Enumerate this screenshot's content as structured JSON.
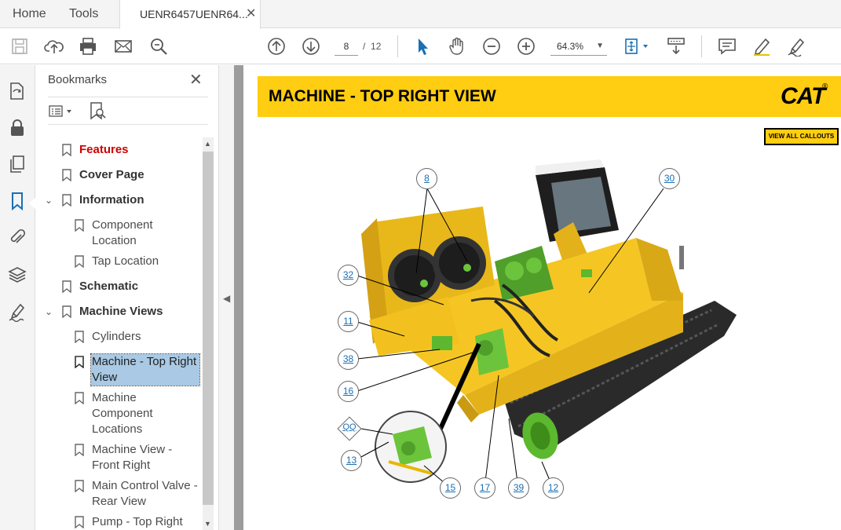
{
  "menu": {
    "home": "Home",
    "tools": "Tools"
  },
  "tab": {
    "title": "UENR6457UENR64...",
    "close": "✕"
  },
  "toolbar": {
    "current_page": "8",
    "page_separator": "/",
    "total_pages": "12",
    "zoom": "64.3%"
  },
  "bookmarks": {
    "title": "Bookmarks",
    "close": "✕",
    "items": [
      {
        "label": "Features"
      },
      {
        "label": "Cover Page"
      },
      {
        "label": "Information"
      },
      {
        "label": "Component\nLocation"
      },
      {
        "label": "Tap Location"
      },
      {
        "label": "Schematic"
      },
      {
        "label": "Machine Views"
      },
      {
        "label": "Cylinders"
      },
      {
        "label": "Machine - Top Right\nView"
      },
      {
        "label": "Machine\nComponent\nLocations"
      },
      {
        "label": "Machine View -\nFront Right"
      },
      {
        "label": "Main Control Valve -\nRear View"
      },
      {
        "label": "Pump - Top Right"
      }
    ]
  },
  "page": {
    "heading": "MACHINE - TOP RIGHT VIEW",
    "logo": "CAT",
    "logo_mark": "®",
    "view_all": "VIEW ALL CALLOUTS",
    "callouts": [
      "8",
      "30",
      "32",
      "11",
      "38",
      "16",
      "QQ",
      "13",
      "15",
      "17",
      "39",
      "12"
    ]
  },
  "colors": {
    "cat_yellow": "#ffcd11",
    "link_blue": "#1a6fb5",
    "selected_bg": "#a9c9e4",
    "features_red": "#cc0000",
    "icon_blue": "#1a6fb5"
  }
}
